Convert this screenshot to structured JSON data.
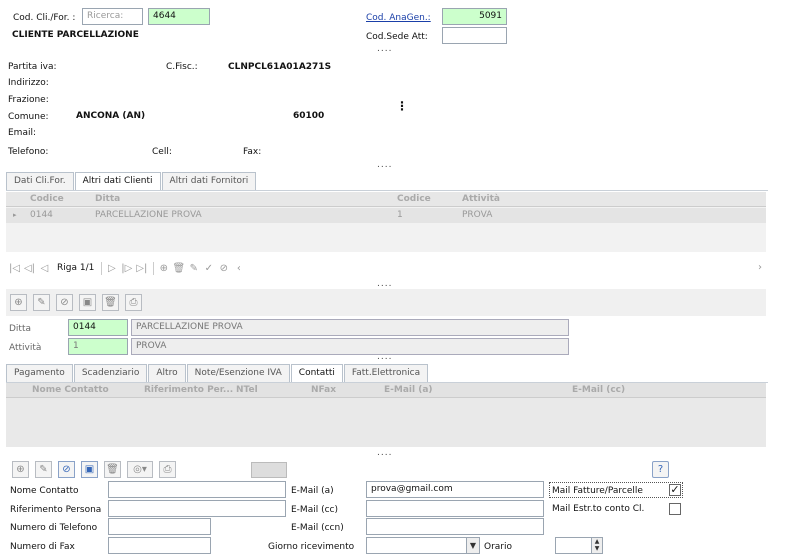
{
  "header": {
    "cod_cli_for_label": "Cod. Cli./For. :",
    "search_placeholder": "Ricerca:",
    "cod_value": "4644",
    "client_name": "CLIENTE PARCELLAZIONE",
    "cod_anagen_label": "Cod. AnaGen.:",
    "cod_anagen_value": "5091",
    "cod_sede_label": "Cod.Sede Att:",
    "cod_sede_value": ""
  },
  "dots": "....",
  "vdots": "⋮",
  "anagrafica": {
    "partita_iva_label": "Partita iva:",
    "cfisc_label": "C.Fisc.:",
    "cfisc_value": "CLNPCL61A01A271S",
    "indirizzo_label": "Indirizzo:",
    "frazione_label": "Frazione:",
    "comune_label": "Comune:",
    "comune_value": "ANCONA (AN)",
    "cap_value": "60100",
    "email_label": "Email:",
    "telefono_label": "Telefono:",
    "cell_label": "Cell:",
    "fax_label": "Fax:"
  },
  "main_tabs": [
    {
      "label": "Dati Cli.For."
    },
    {
      "label": "Altri dati Clienti"
    },
    {
      "label": "Altri dati Fornitori"
    }
  ],
  "ditte_grid": {
    "columns": [
      "Codice",
      "Ditta",
      "Codice",
      "Attività"
    ],
    "rows": [
      {
        "codice": "0144",
        "ditta": "PARCELLAZIONE PROVA",
        "codice_att": "1",
        "attivita": "PROVA"
      }
    ]
  },
  "pager": {
    "label": "Riga 1/1",
    "first": "|◁",
    "prev_page": "◁|",
    "prev": "◁",
    "next": "▷",
    "next_page": "|▷",
    "last": "▷|",
    "add": "⊕",
    "delete": "🗑",
    "edit": "✎",
    "confirm": "✓",
    "cancel": "⊘",
    "scroll_left": "‹",
    "scroll_right": "›"
  },
  "toolbar_icons": {
    "add": "⊕",
    "edit": "✎",
    "cancel": "⊘",
    "save": "▣",
    "delete": "🗑",
    "print": "⎙",
    "options": "◎▾",
    "help": "?"
  },
  "ditta_detail": {
    "ditta_label": "Ditta",
    "ditta_code": "0144",
    "ditta_name": "PARCELLAZIONE PROVA",
    "attivita_label": "Attività",
    "attivita_code": "1",
    "attivita_name": "PROVA"
  },
  "sub_tabs": [
    {
      "label": "Pagamento"
    },
    {
      "label": "Scadenziario"
    },
    {
      "label": "Altro"
    },
    {
      "label": "Note/Esenzione IVA"
    },
    {
      "label": "Contatti"
    },
    {
      "label": "Fatt.Elettronica"
    }
  ],
  "contacts_grid": {
    "columns": [
      "Nome Contatto",
      "Riferimento Per...",
      "NTel",
      "NFax",
      "E-Mail (a)",
      "E-Mail (cc)"
    ]
  },
  "contact_form": {
    "nome_label": "Nome Contatto",
    "nome_value": "",
    "rif_label": "Riferimento Persona",
    "rif_value": "",
    "tel_label": "Numero di Telefono",
    "tel_value": "",
    "fax_label": "Numero di Fax",
    "fax_value": "",
    "email_a_label": "E-Mail (a)",
    "email_a_value": "prova@gmail.com",
    "email_cc_label": "E-Mail (cc)",
    "email_cc_value": "",
    "email_ccn_label": "E-Mail (ccn)",
    "email_ccn_value": "",
    "giorno_label": "Giorno ricevimento",
    "giorno_value": "",
    "orario_label": "Orario",
    "orario_value": "",
    "mail_fatture_label": "Mail Fatture/Parcelle",
    "mail_fatture_checked": "✓",
    "mail_estr_label": "Mail Estr.to conto Cl.",
    "dropdown_arrow": "▼",
    "spin_up": "▲",
    "spin_down": "▼"
  }
}
